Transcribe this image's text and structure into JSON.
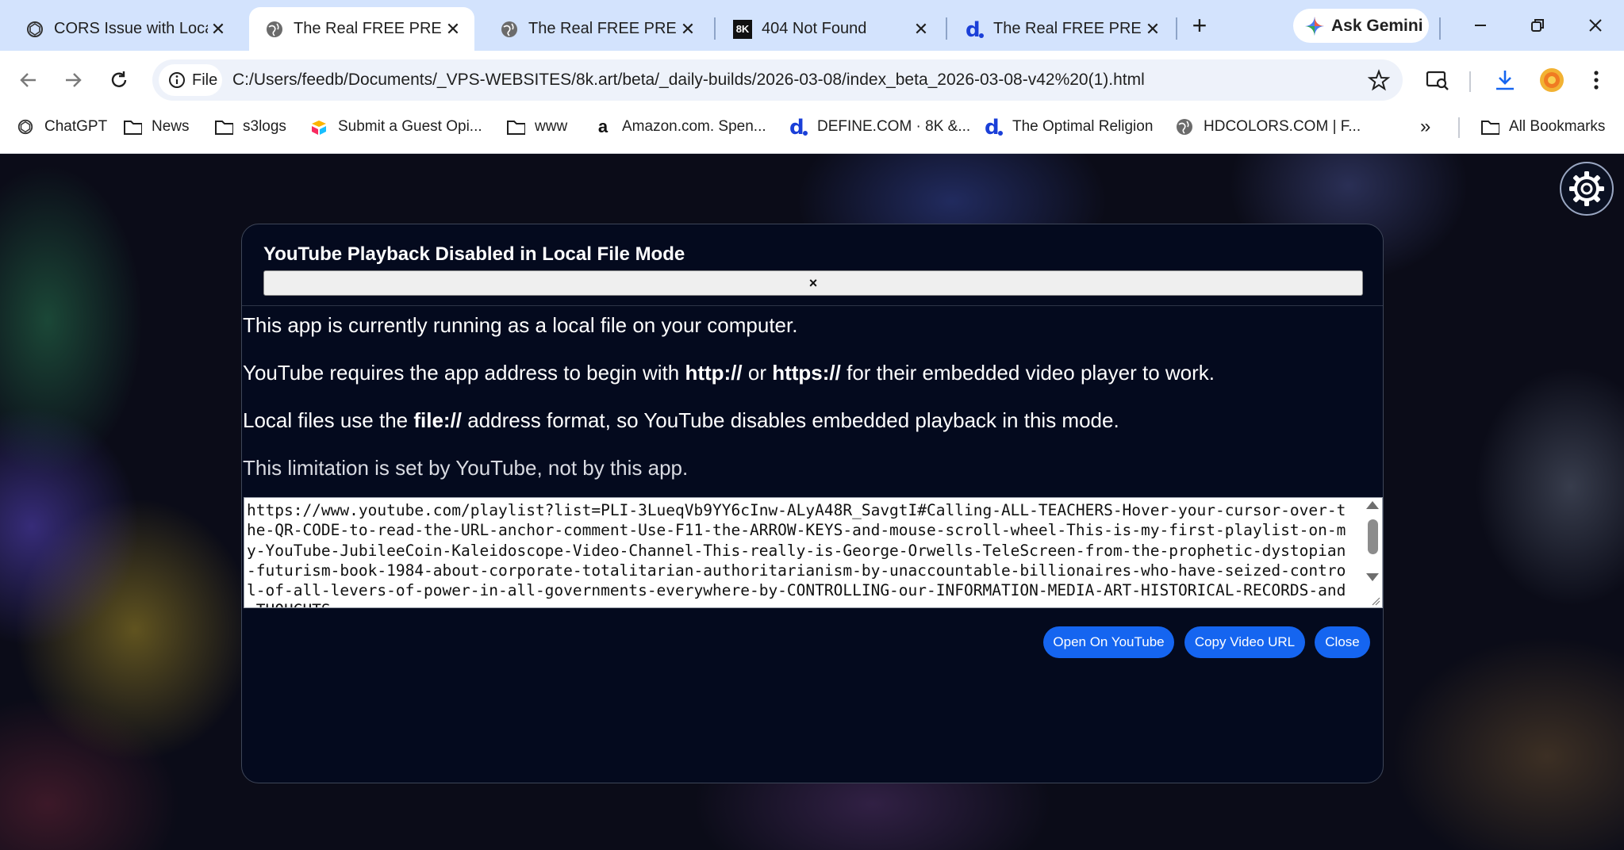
{
  "browser": {
    "tabs": [
      {
        "title": "CORS Issue with Loca",
        "favicon": "openai-icon"
      },
      {
        "title": "The Real FREE PRESS",
        "favicon": "globe-icon",
        "active": true
      },
      {
        "title": "The Real FREE PRESS",
        "favicon": "globe-icon"
      },
      {
        "title": "404 Not Found",
        "favicon": "8k-logo",
        "favicon_text": "8K"
      },
      {
        "title": "The Real FREE PRESS",
        "favicon": "d-logo"
      }
    ],
    "ask_gemini": "Ask Gemini",
    "omnibox": {
      "chip": "File",
      "url": "C:/Users/feedb/Documents/_VPS-WEBSITES/8k.art/beta/_daily-builds/2026-03-08/index_beta_2026-03-08-v42%20(1).html"
    },
    "bookmarks": [
      {
        "label": "ChatGPT",
        "icon": "openai-icon"
      },
      {
        "label": "News",
        "icon": "folder-icon"
      },
      {
        "label": "s3logs",
        "icon": "folder-icon"
      },
      {
        "label": "Submit a Guest Opi...",
        "icon": "airtable-icon"
      },
      {
        "label": "www",
        "icon": "folder-icon"
      },
      {
        "label": "Amazon.com. Spen...",
        "icon": "amazon-icon"
      },
      {
        "label": "DEFINE.COM · 8K &...",
        "icon": "d-logo"
      },
      {
        "label": "The Optimal Religion",
        "icon": "d-logo"
      },
      {
        "label": "HDCOLORS.COM | F...",
        "icon": "globe-icon"
      }
    ],
    "all_bookmarks": "All Bookmarks",
    "colors": {
      "tabstrip": "#d3e3fd",
      "accent": "#1565f0"
    }
  },
  "modal": {
    "title": "YouTube Playback Disabled in Local File Mode",
    "close_symbol": "×",
    "paragraph1": "This app is currently running as a local file on your computer.",
    "paragraph2": {
      "pre": "YouTube requires the app address to begin with ",
      "b1": "http://",
      "mid": " or ",
      "b2": "https://",
      "post": " for their embedded video player to work."
    },
    "paragraph3": {
      "pre": "Local files use the ",
      "b1": "file://",
      "post": " address format, so YouTube disables embedded playback in this mode."
    },
    "paragraph4": "This limitation is set by YouTube, not by this app.",
    "video_url": "https://www.youtube.com/playlist?list=PLI-3LueqVb9YY6cInw-ALyA48R_SavgtI#Calling-ALL-TEACHERS-Hover-your-cursor-over-the-QR-CODE-to-read-the-URL-anchor-comment-Use-F11-the-ARROW-KEYS-and-mouse-scroll-wheel-This-is-my-first-playlist-on-my-YouTube-JubileeCoin-Kaleidoscope-Video-Channel-This-really-is-George-Orwells-TeleScreen-from-the-prophetic-dystopian-futurism-book-1984-about-corporate-totalitarian-authoritarianism-by-unaccountable-billionaires-who-have-seized-control-of-all-levers-of-power-in-all-governments-everywhere-by-CONTROLLING-our-INFORMATION-MEDIA-ART-HISTORICAL-RECORDS-and-THOUGHTS",
    "buttons": {
      "open": "Open On YouTube",
      "copy": "Copy Video URL",
      "close": "Close"
    }
  }
}
